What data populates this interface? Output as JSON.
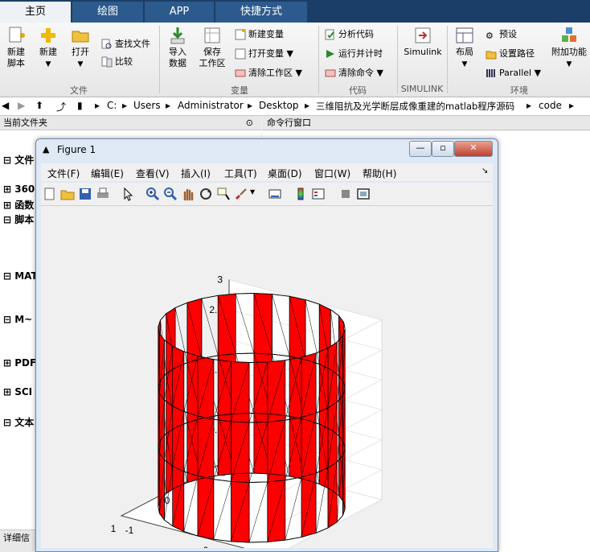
{
  "tabs": [
    {
      "label": "主页",
      "active": true
    },
    {
      "label": "绘图",
      "active": false
    },
    {
      "label": "APP",
      "active": false
    },
    {
      "label": "快捷方式",
      "active": false
    }
  ],
  "ribbon": {
    "file": {
      "new_script": "新建\n脚本",
      "new": "新建",
      "open": "打开",
      "find_files": "查找文件",
      "compare": "比较",
      "group": "文件"
    },
    "variable": {
      "import": "导入\n数据",
      "save_ws": "保存\n工作区",
      "new_var": "新建变量",
      "open_var": "打开变量",
      "clear_ws": "清除工作区",
      "group": "变量"
    },
    "code": {
      "analyze": "分析代码",
      "run_time": "运行并计时",
      "clear_cmd": "清除命令",
      "group": "代码"
    },
    "simulink": {
      "label": "Simulink",
      "group": "SIMULINK"
    },
    "env": {
      "layout": "布局",
      "prefs": "预设",
      "set_path": "设置路径",
      "parallel": "Parallel",
      "addons": "附加功能",
      "group": "环境"
    }
  },
  "address": {
    "parts": [
      "C:",
      "Users",
      "Administrator",
      "Desktop",
      "三维阻抗及光学断层成像重建的matlab程序源码",
      "code"
    ]
  },
  "left": {
    "header": "当前文件夹",
    "rows": [
      "文件",
      "360",
      "函数",
      "脚本",
      "MAT",
      "M~",
      "PDF",
      "SCI",
      "文本"
    ],
    "footer": "详细信"
  },
  "cmd": {
    "header": "命令行窗口"
  },
  "figure": {
    "title": "Figure 1",
    "menus": [
      "文件(F)",
      "编辑(E)",
      "查看(V)",
      "插入(I)",
      "工具(T)",
      "桌面(D)",
      "窗口(W)",
      "帮助(H)"
    ],
    "colors": {
      "fill": "#ff0000",
      "edge": "#000000"
    }
  },
  "chart_data": {
    "type": "surface",
    "description_free": true,
    "zlim": [
      0,
      3
    ],
    "xlim": [
      -1,
      1
    ],
    "ylim": [
      -1,
      1
    ],
    "zticks": [
      "0",
      "0.5",
      "1",
      "1.5",
      "2",
      "2.5",
      "3"
    ],
    "xticks": [
      "-1",
      "0",
      "1"
    ],
    "yticks": [
      "-1",
      "0",
      "1"
    ],
    "cylinder": {
      "radius": 1,
      "z_min": 0,
      "z_max": 3,
      "rings": [
        0,
        1,
        2,
        3
      ]
    }
  }
}
